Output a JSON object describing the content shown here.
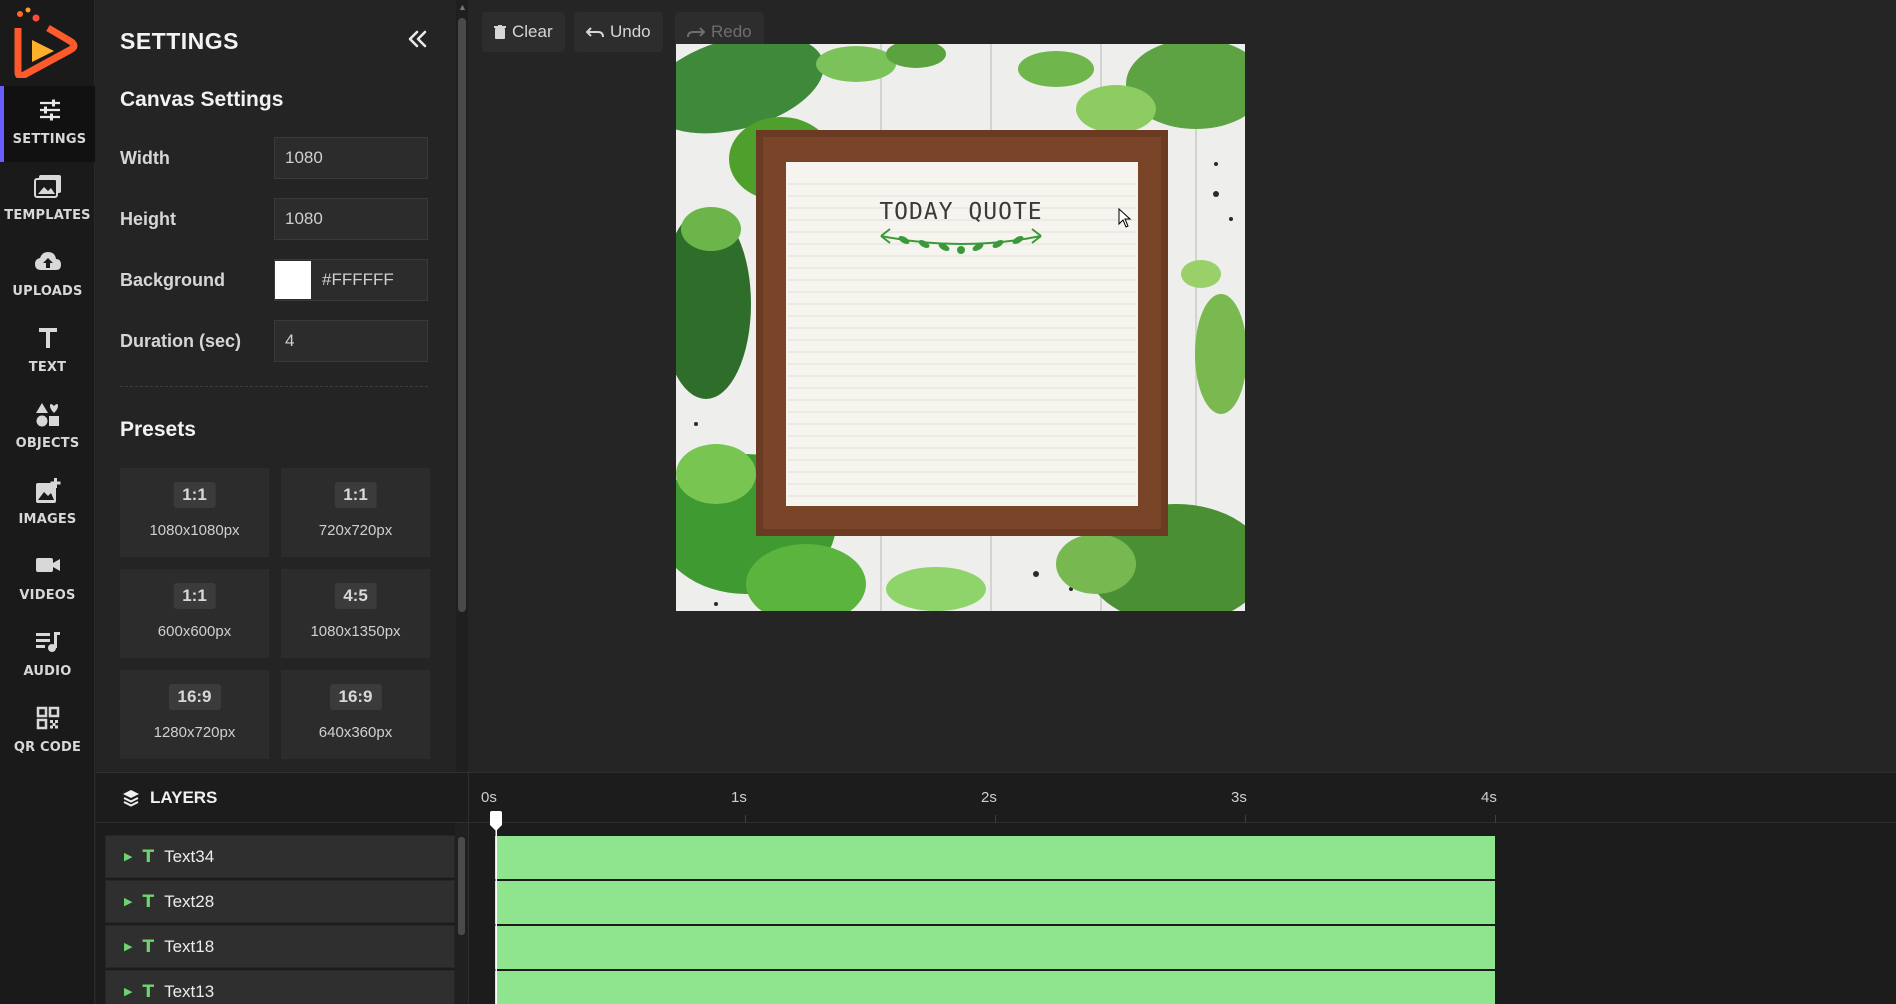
{
  "rail": {
    "items": [
      {
        "label": "SETTINGS",
        "icon": "sliders-icon",
        "active": true
      },
      {
        "label": "TEMPLATES",
        "icon": "image-stack-icon"
      },
      {
        "label": "UPLOADS",
        "icon": "cloud-upload-icon"
      },
      {
        "label": "TEXT",
        "icon": "text-t-icon"
      },
      {
        "label": "OBJECTS",
        "icon": "shapes-icon"
      },
      {
        "label": "IMAGES",
        "icon": "add-image-icon"
      },
      {
        "label": "VIDEOS",
        "icon": "video-camera-icon"
      },
      {
        "label": "AUDIO",
        "icon": "music-list-icon"
      },
      {
        "label": "QR CODE",
        "icon": "qr-code-icon"
      }
    ]
  },
  "settings": {
    "title": "SETTINGS",
    "canvas_settings_heading": "Canvas Settings",
    "width_label": "Width",
    "width_value": "1080",
    "height_label": "Height",
    "height_value": "1080",
    "background_label": "Background",
    "background_value": "#FFFFFF",
    "duration_label": "Duration (sec)",
    "duration_value": "4",
    "presets_heading": "Presets",
    "presets": [
      {
        "ratio": "1:1",
        "dims": "1080x1080px"
      },
      {
        "ratio": "1:1",
        "dims": "720x720px"
      },
      {
        "ratio": "1:1",
        "dims": "600x600px"
      },
      {
        "ratio": "4:5",
        "dims": "1080x1350px"
      },
      {
        "ratio": "16:9",
        "dims": "1280x720px"
      },
      {
        "ratio": "16:9",
        "dims": "640x360px"
      }
    ]
  },
  "toolbar": {
    "clear_label": "Clear",
    "undo_label": "Undo",
    "redo_label": "Redo"
  },
  "canvas": {
    "quote_title": "TODAY QUOTE"
  },
  "layers": {
    "heading": "LAYERS",
    "items": [
      "Text34",
      "Text28",
      "Text18",
      "Text13"
    ]
  },
  "timeline": {
    "ticks": [
      "0s",
      "1s",
      "2s",
      "3s",
      "4s"
    ],
    "duration_seconds": 4,
    "playhead_seconds": 0,
    "track_color": "#8ee58e"
  },
  "colors": {
    "accent": "#6a5cff",
    "track": "#8ee58e",
    "layer_icon": "#6fd36f"
  }
}
